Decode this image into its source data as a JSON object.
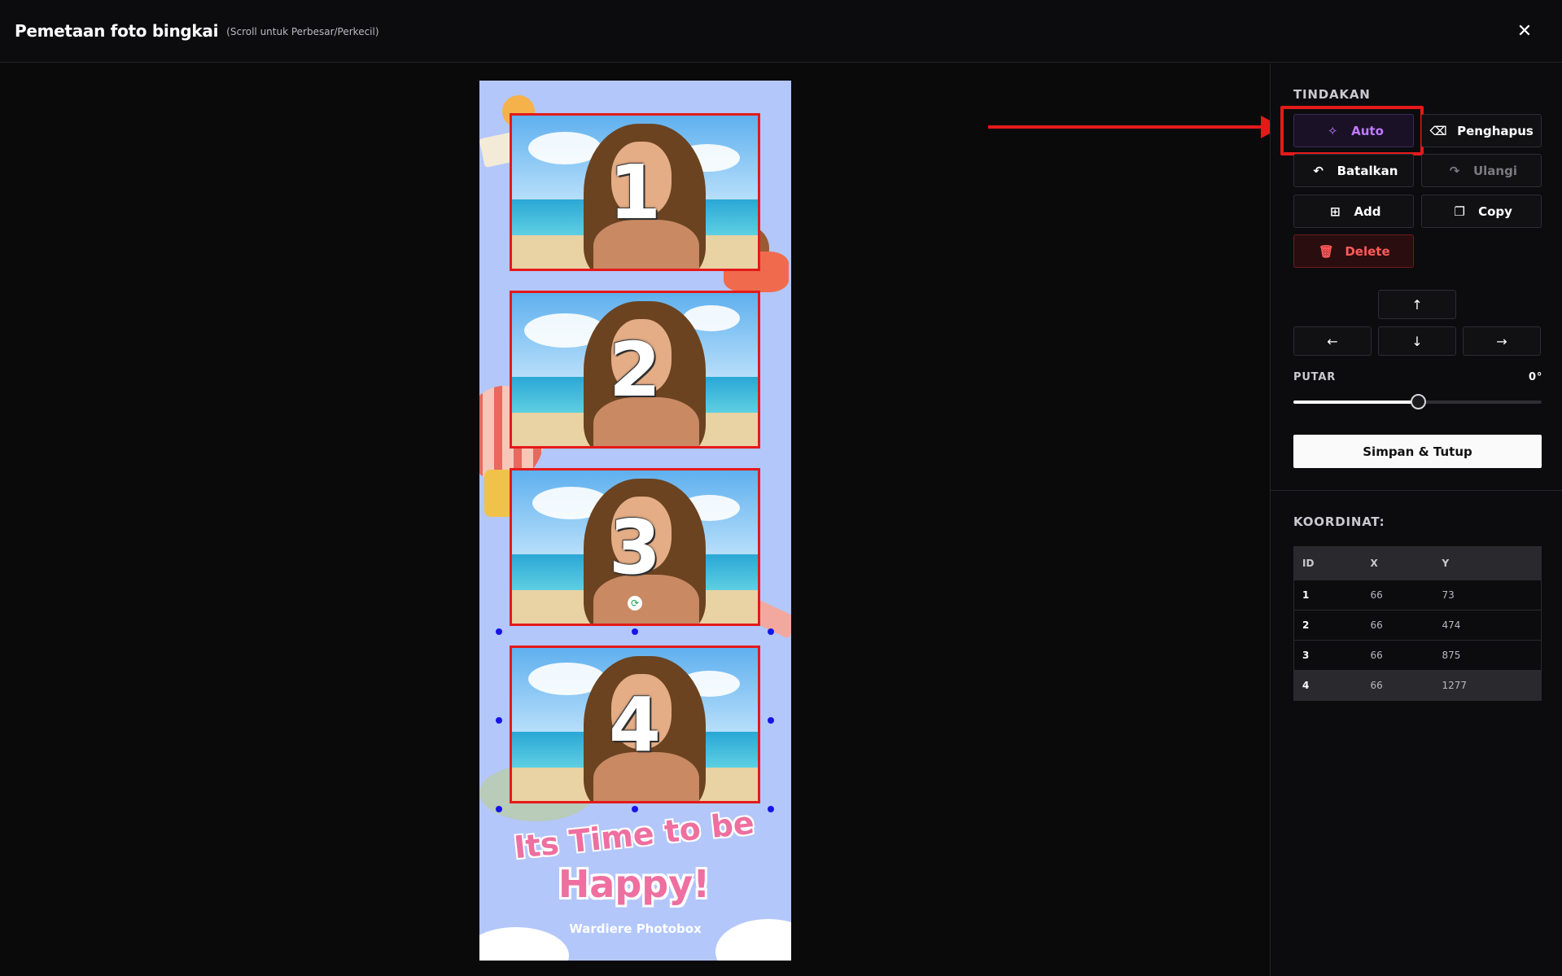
{
  "header": {
    "title": "Pemetaan foto bingkai",
    "subtitle": "(Scroll untuk Perbesar/Perkecil)",
    "close_icon": "close-icon"
  },
  "frame": {
    "slots": [
      "1",
      "2",
      "3",
      "4"
    ],
    "headline_line1": "Its Time to be",
    "headline_line2": "Happy!",
    "brand": "Wardiere Photobox"
  },
  "actions": {
    "section_title": "TINDAKAN",
    "auto": "Auto",
    "eraser": "Penghapus",
    "undo": "Batalkan",
    "redo": "Ulangi",
    "add": "Add",
    "copy": "Copy",
    "delete": "Delete",
    "arrow_up": "↑",
    "arrow_left": "←",
    "arrow_down": "↓",
    "arrow_right": "→"
  },
  "rotate": {
    "label": "PUTAR",
    "value": "0°",
    "fraction": 0.5
  },
  "save_label": "Simpan & Tutup",
  "coordinates": {
    "title": "KOORDINAT:",
    "headers": [
      "ID",
      "X",
      "Y"
    ],
    "rows": [
      {
        "id": "1",
        "x": "66",
        "y": "73"
      },
      {
        "id": "2",
        "x": "66",
        "y": "474"
      },
      {
        "id": "3",
        "x": "66",
        "y": "875"
      },
      {
        "id": "4",
        "x": "66",
        "y": "1277"
      }
    ],
    "selected_row": 4
  },
  "colors": {
    "accent_auto": "#c079ff",
    "delete": "#ff5a5a",
    "highlight": "#e41a1a",
    "frame_bg": "#b3c7fb"
  }
}
